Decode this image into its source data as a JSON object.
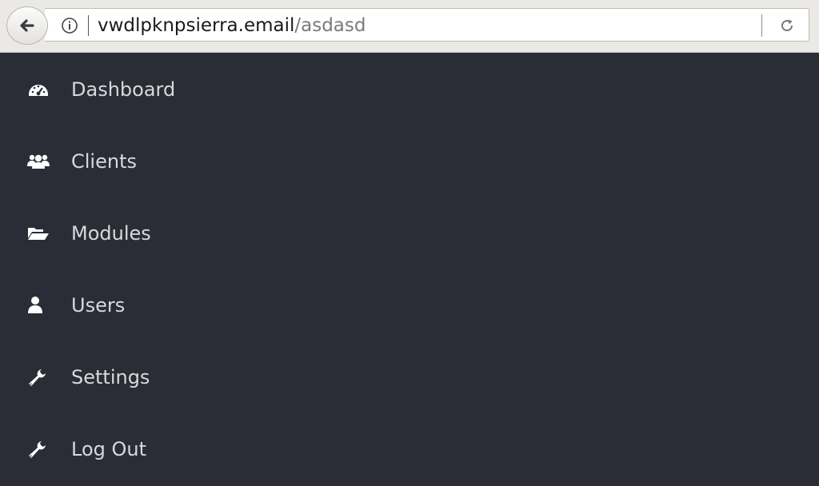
{
  "browser": {
    "url_host": "vwdlpknpsierra.email",
    "url_path": "/asdasd",
    "back_icon": "back-arrow-icon",
    "info_icon": "info-icon",
    "reload_icon": "reload-icon"
  },
  "menu": {
    "items": [
      {
        "label": "Dashboard",
        "icon": "dashboard-gauge-icon"
      },
      {
        "label": "Clients",
        "icon": "users-group-icon"
      },
      {
        "label": "Modules",
        "icon": "folder-open-icon"
      },
      {
        "label": "Users",
        "icon": "user-icon"
      },
      {
        "label": "Settings",
        "icon": "wrench-icon"
      },
      {
        "label": "Log Out",
        "icon": "wrench-icon"
      }
    ]
  },
  "colors": {
    "sidebar_bg": "#2a2d35",
    "menu_text": "#d9d9dc",
    "browser_chrome": "#ebe9e6"
  }
}
